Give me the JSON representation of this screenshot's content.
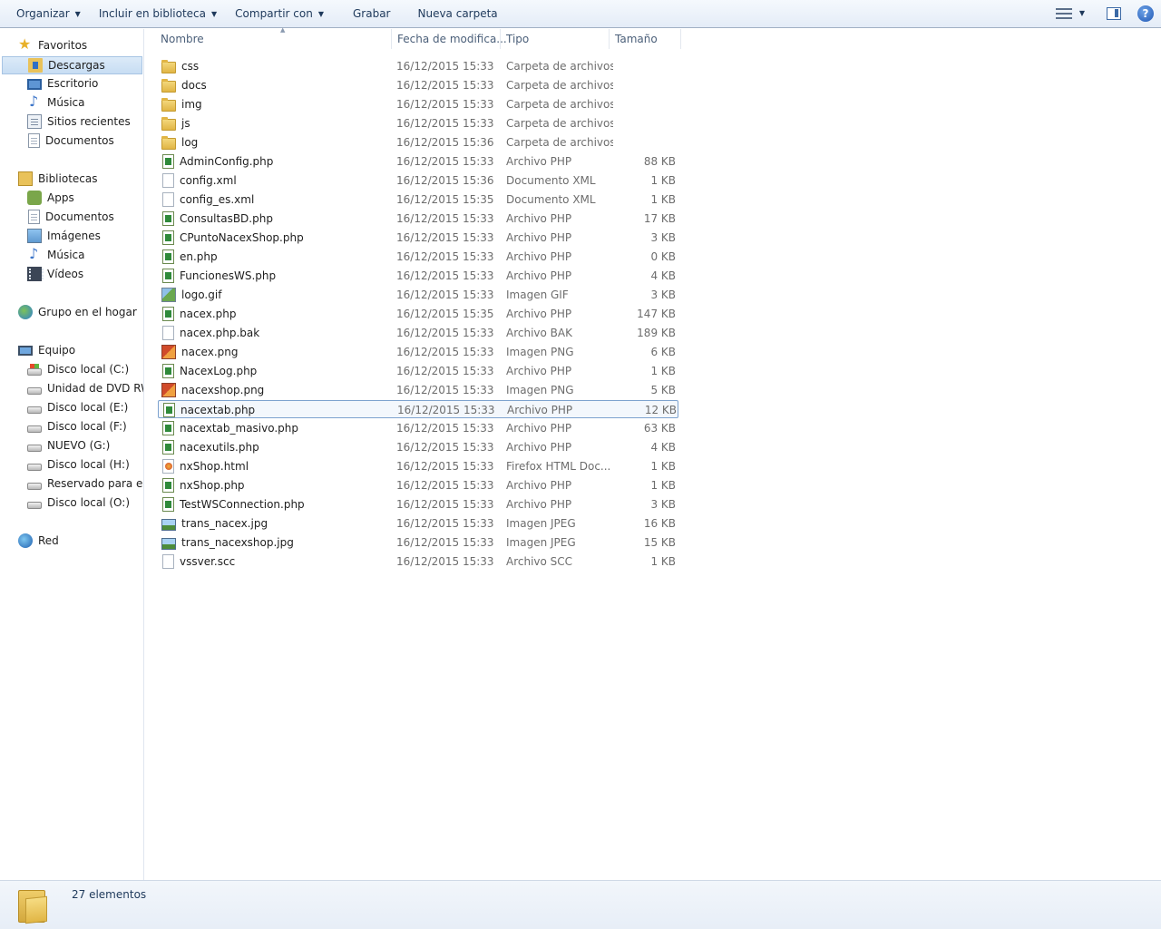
{
  "toolbar": {
    "organize": "Organizar",
    "include_library": "Incluir en biblioteca",
    "share_with": "Compartir con",
    "burn": "Grabar",
    "new_folder": "Nueva carpeta",
    "help": "?"
  },
  "nav": {
    "favorites": "Favoritos",
    "downloads": "Descargas",
    "desktop": "Escritorio",
    "music": "Música",
    "recent": "Sitios recientes",
    "documents": "Documentos",
    "libraries": "Bibliotecas",
    "lib_apps": "Apps",
    "lib_documents": "Documentos",
    "lib_images": "Imágenes",
    "lib_music": "Música",
    "lib_videos": "Vídeos",
    "homegroup": "Grupo en el hogar",
    "computer": "Equipo",
    "drive_c": "Disco local (C:)",
    "drive_dvd": "Unidad de DVD RW (",
    "drive_e": "Disco local (E:)",
    "drive_f": "Disco local (F:)",
    "drive_g": "NUEVO (G:)",
    "drive_h": "Disco local (H:)",
    "drive_reserved": "Reservado para el sis",
    "drive_o": "Disco local (O:)",
    "network": "Red"
  },
  "columns": {
    "name": "Nombre",
    "date": "Fecha de modifica...",
    "type": "Tipo",
    "size": "Tamaño"
  },
  "files": [
    {
      "name": "css",
      "date": "16/12/2015 15:33",
      "type": "Carpeta de archivos",
      "size": "",
      "icon": "folder-icon"
    },
    {
      "name": "docs",
      "date": "16/12/2015 15:33",
      "type": "Carpeta de archivos",
      "size": "",
      "icon": "folder-icon"
    },
    {
      "name": "img",
      "date": "16/12/2015 15:33",
      "type": "Carpeta de archivos",
      "size": "",
      "icon": "folder-icon"
    },
    {
      "name": "js",
      "date": "16/12/2015 15:33",
      "type": "Carpeta de archivos",
      "size": "",
      "icon": "folder-icon"
    },
    {
      "name": "log",
      "date": "16/12/2015 15:36",
      "type": "Carpeta de archivos",
      "size": "",
      "icon": "folder-icon"
    },
    {
      "name": "AdminConfig.php",
      "date": "16/12/2015 15:33",
      "type": "Archivo PHP",
      "size": "88 KB",
      "icon": "php-file-icon"
    },
    {
      "name": "config.xml",
      "date": "16/12/2015 15:36",
      "type": "Documento XML",
      "size": "1 KB",
      "icon": "blank-file-icon"
    },
    {
      "name": "config_es.xml",
      "date": "16/12/2015 15:35",
      "type": "Documento XML",
      "size": "1 KB",
      "icon": "blank-file-icon"
    },
    {
      "name": "ConsultasBD.php",
      "date": "16/12/2015 15:33",
      "type": "Archivo PHP",
      "size": "17 KB",
      "icon": "php-file-icon"
    },
    {
      "name": "CPuntoNacexShop.php",
      "date": "16/12/2015 15:33",
      "type": "Archivo PHP",
      "size": "3 KB",
      "icon": "php-file-icon"
    },
    {
      "name": "en.php",
      "date": "16/12/2015 15:33",
      "type": "Archivo PHP",
      "size": "0 KB",
      "icon": "php-file-icon"
    },
    {
      "name": "FuncionesWS.php",
      "date": "16/12/2015 15:33",
      "type": "Archivo PHP",
      "size": "4 KB",
      "icon": "php-file-icon"
    },
    {
      "name": "logo.gif",
      "date": "16/12/2015 15:33",
      "type": "Imagen GIF",
      "size": "3 KB",
      "icon": "gif-image-icon"
    },
    {
      "name": "nacex.php",
      "date": "16/12/2015 15:35",
      "type": "Archivo PHP",
      "size": "147 KB",
      "icon": "php-file-icon"
    },
    {
      "name": "nacex.php.bak",
      "date": "16/12/2015 15:33",
      "type": "Archivo BAK",
      "size": "189 KB",
      "icon": "blank-file-icon"
    },
    {
      "name": "nacex.png",
      "date": "16/12/2015 15:33",
      "type": "Imagen PNG",
      "size": "6 KB",
      "icon": "png-image-icon"
    },
    {
      "name": "NacexLog.php",
      "date": "16/12/2015 15:33",
      "type": "Archivo PHP",
      "size": "1 KB",
      "icon": "php-file-icon"
    },
    {
      "name": "nacexshop.png",
      "date": "16/12/2015 15:33",
      "type": "Imagen PNG",
      "size": "5 KB",
      "icon": "png-image-icon"
    },
    {
      "name": "nacextab.php",
      "date": "16/12/2015 15:33",
      "type": "Archivo PHP",
      "size": "12 KB",
      "icon": "php-file-icon",
      "selected": true
    },
    {
      "name": "nacextab_masivo.php",
      "date": "16/12/2015 15:33",
      "type": "Archivo PHP",
      "size": "63 KB",
      "icon": "php-file-icon"
    },
    {
      "name": "nacexutils.php",
      "date": "16/12/2015 15:33",
      "type": "Archivo PHP",
      "size": "4 KB",
      "icon": "php-file-icon"
    },
    {
      "name": "nxShop.html",
      "date": "16/12/2015 15:33",
      "type": "Firefox HTML Doc...",
      "size": "1 KB",
      "icon": "html-file-icon"
    },
    {
      "name": "nxShop.php",
      "date": "16/12/2015 15:33",
      "type": "Archivo PHP",
      "size": "1 KB",
      "icon": "php-file-icon"
    },
    {
      "name": "TestWSConnection.php",
      "date": "16/12/2015 15:33",
      "type": "Archivo PHP",
      "size": "3 KB",
      "icon": "php-file-icon"
    },
    {
      "name": "trans_nacex.jpg",
      "date": "16/12/2015 15:33",
      "type": "Imagen JPEG",
      "size": "16 KB",
      "icon": "jpeg-image-icon"
    },
    {
      "name": "trans_nacexshop.jpg",
      "date": "16/12/2015 15:33",
      "type": "Imagen JPEG",
      "size": "15 KB",
      "icon": "jpeg-image-icon"
    },
    {
      "name": "vssver.scc",
      "date": "16/12/2015 15:33",
      "type": "Archivo SCC",
      "size": "1 KB",
      "icon": "blank-file-icon"
    }
  ],
  "status": {
    "count": "27 elementos"
  }
}
